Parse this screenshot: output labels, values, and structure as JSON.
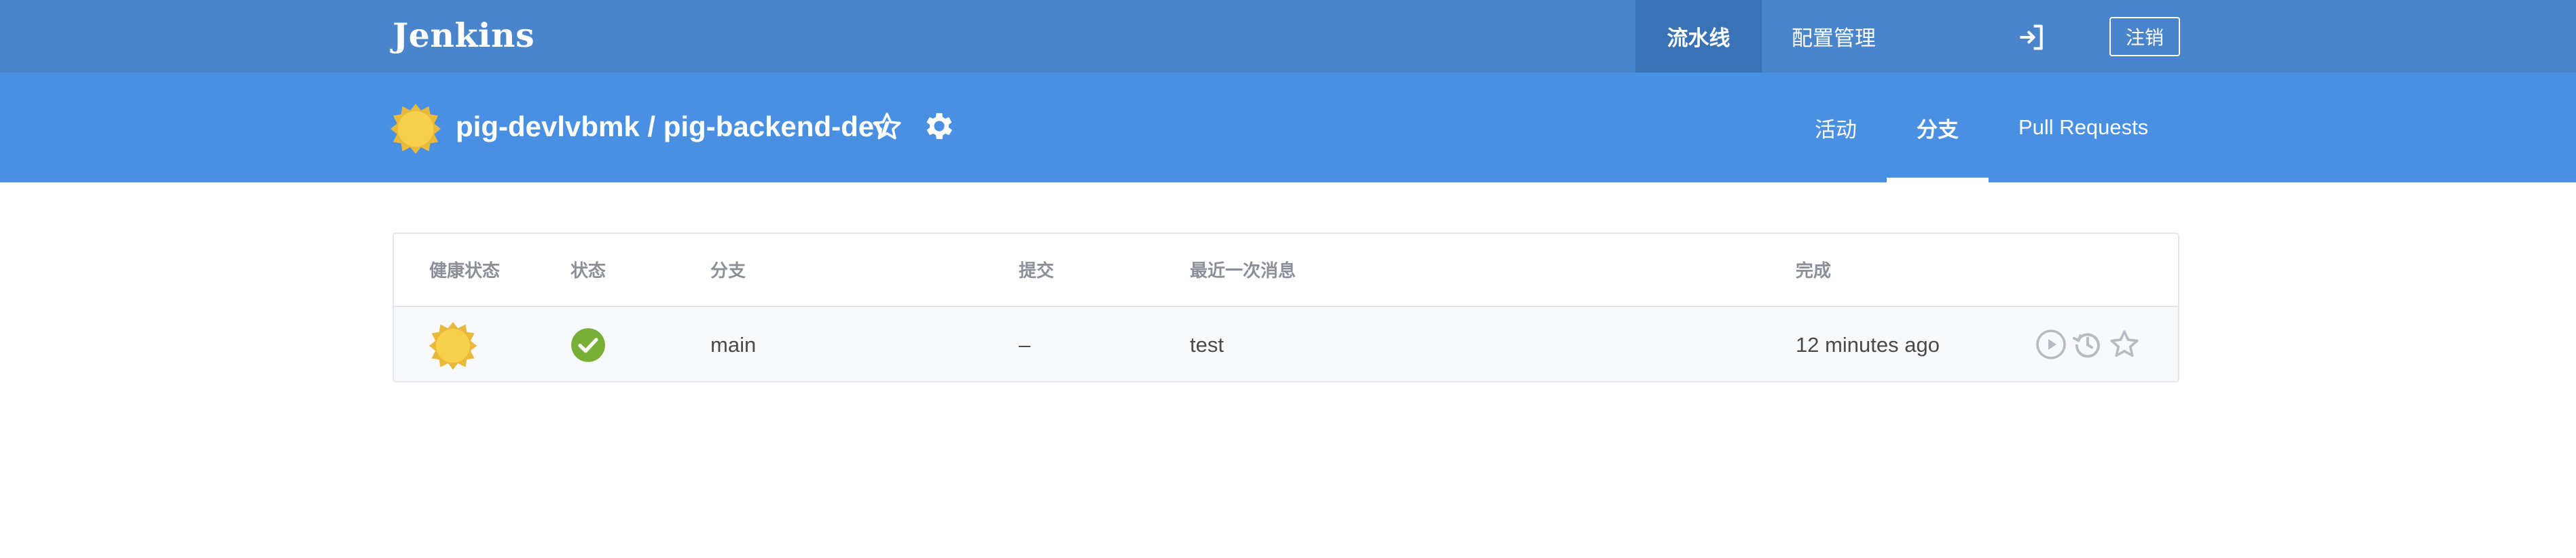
{
  "header": {
    "brand": "Jenkins",
    "nav": [
      {
        "label": "流水线",
        "active": true
      },
      {
        "label": "配置管理",
        "active": false
      }
    ],
    "exit_icon": "sign-out-icon",
    "logout_label": "注销",
    "colors": {
      "topbar": "#4a85cc",
      "topbar_active": "#3a72b6"
    }
  },
  "pipeline": {
    "title": "pig-devlvbmk / pig-backend-dev",
    "health_icon": "sunny-weather-icon",
    "favorite_icon": "star-outline-icon",
    "settings_icon": "gear-icon",
    "tabs": [
      {
        "label": "活动",
        "active": false
      },
      {
        "label": "分支",
        "active": true
      },
      {
        "label": "Pull Requests",
        "active": false
      }
    ],
    "colors": {
      "subbar": "#4a90e2"
    }
  },
  "branches_table": {
    "columns": [
      "健康状态",
      "状态",
      "分支",
      "提交",
      "最近一次消息",
      "完成"
    ],
    "rows": [
      {
        "health": "sunny-weather-icon",
        "status": "success-check-icon",
        "branch": "main",
        "commit": "–",
        "message": "test",
        "completed": "12 minutes ago",
        "actions": [
          "run-play-icon",
          "replay-history-icon",
          "favorite-star-icon"
        ]
      }
    ],
    "colors": {
      "success": "#78b037",
      "sun": "#f6d04d",
      "icon_gray": "#b8bcc2"
    }
  }
}
